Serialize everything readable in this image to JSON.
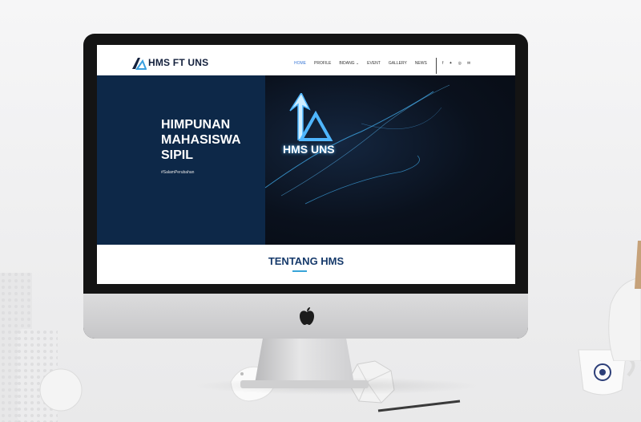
{
  "site": {
    "brand": "HMS FT UNS",
    "nav": [
      {
        "label": "HOME",
        "active": true
      },
      {
        "label": "PROFILE",
        "active": false
      },
      {
        "label": "BIDANG ⌄",
        "active": false
      },
      {
        "label": "EVENT",
        "active": false
      },
      {
        "label": "GALLERY",
        "active": false
      },
      {
        "label": "NEWS",
        "active": false
      }
    ],
    "social_icons": [
      "facebook-icon",
      "twitter-icon",
      "instagram-icon",
      "email-icon"
    ],
    "hero": {
      "line1": "HIMPUNAN",
      "line2": "MAHASISWA",
      "line3": "SIPIL",
      "tag": "#SalamPerubahan",
      "logo_text": "HMS UNS"
    },
    "about_title": "TENTANG HMS",
    "colors": {
      "accent": "#3d7ad6",
      "brand_navy": "#14213d",
      "hero_left": "#0d2848",
      "title_blue": "#163a6b"
    }
  }
}
